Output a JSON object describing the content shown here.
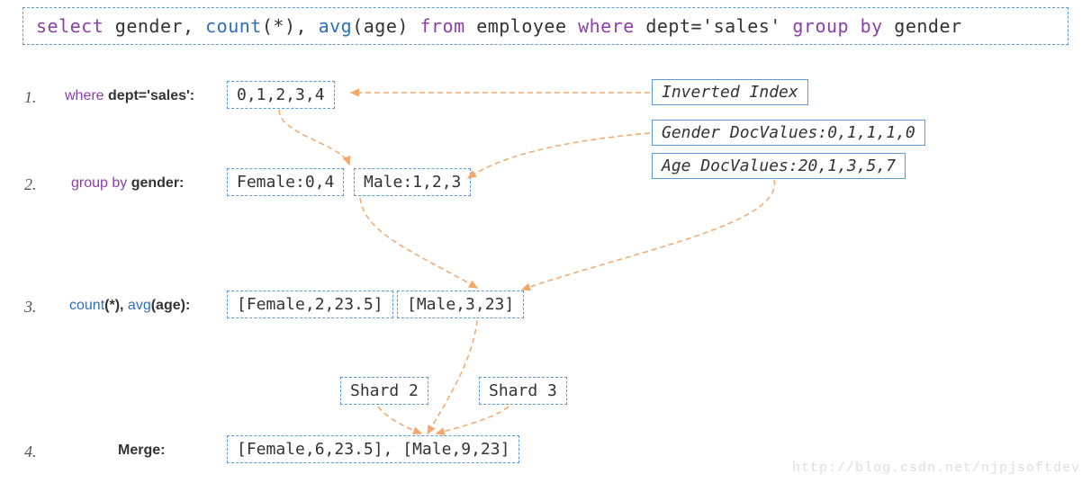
{
  "sql": {
    "select": "select",
    "col1": "gender,",
    "count": "count",
    "count_arg": "(*),",
    "avg": "avg",
    "avg_arg": "(age)",
    "from": "from",
    "table": "employee",
    "where": "where",
    "where_cond": "dept='sales'",
    "group": "group",
    "by_kw": "by",
    "by_col": "gender"
  },
  "steps": {
    "s1": {
      "num": "1.",
      "kw": "where",
      "txt": " dept='sales':",
      "box": "0,1,2,3,4"
    },
    "s2": {
      "num": "2.",
      "kw": "group by",
      "txt": " gender:",
      "box1": "Female:0,4",
      "box2": "Male:1,2,3"
    },
    "s3": {
      "num": "3.",
      "kw1": "count",
      "arg1": "(*),  ",
      "kw2": "avg",
      "arg2": "(age):",
      "box1": "[Female,2,23.5]",
      "box2": "[Male,3,23]"
    },
    "shard2": "Shard 2",
    "shard3": "Shard 3",
    "s4": {
      "num": "4.",
      "txt": "Merge:",
      "box": "[Female,6,23.5], [Male,9,23]"
    }
  },
  "side": {
    "inverted": "Inverted Index",
    "gender_dv": "Gender DocValues:0,1,1,1,0",
    "age_dv": "Age DocValues:20,1,3,5,7"
  },
  "watermark": "http://blog.csdn.net/njpjsoftdev"
}
